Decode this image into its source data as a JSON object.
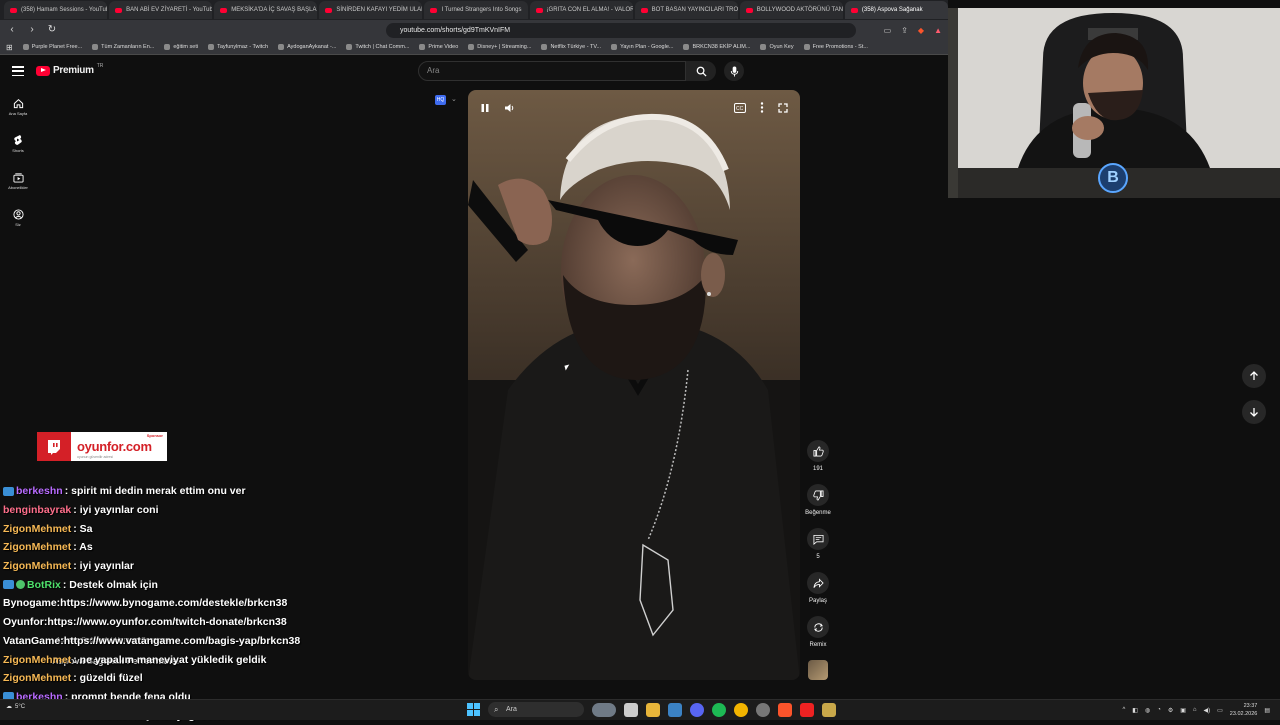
{
  "browser": {
    "tabs": [
      {
        "title": "(358) Hamam Sessions - YouTube"
      },
      {
        "title": "BAN ABİ EV ZİYARETİ - YouTube"
      },
      {
        "title": "MEKSİKA'DA İÇ SAVAŞ BAŞLADI"
      },
      {
        "title": "SİNİRDEN KAFAYI YEDİM ULAN"
      },
      {
        "title": "I Turned Strangers Into Songs"
      },
      {
        "title": "¡GRITA CON EL ALMA! - VALOR"
      },
      {
        "title": "BOT BASAN YAYINCILARI TROLLE"
      },
      {
        "title": "BOLLYWOOD AKTÖRÜNÜ TANI"
      },
      {
        "title": "(358) Aspova Sağanak"
      }
    ],
    "url": "youtube.com/shorts/gd9TmKVnIFM",
    "bookmarks": [
      "Purple Planet Free...",
      "Tüm Zamanların En...",
      "eğitim seti",
      "Tayfunylmaz - Twitch",
      "AydoganAykanat -...",
      "Twitch | Chat Comm...",
      "Prime Video",
      "Disney+ | Streaming...",
      "Netflix Türkiye - TV...",
      "Yayın Plan - Google...",
      "BRKCN38 EKİP ALIM...",
      "Oyun Key",
      "Free Promotions - St..."
    ]
  },
  "youtube": {
    "logo_text": "Premium",
    "logo_region": "TR",
    "search_placeholder": "Ara",
    "sidebar": [
      {
        "label": "Ana Sayfa",
        "icon": "home-icon"
      },
      {
        "label": "Shorts",
        "icon": "shorts-icon"
      },
      {
        "label": "Abonelikler",
        "icon": "subscriptions-icon"
      },
      {
        "label": "Siz",
        "icon": "profile-icon"
      }
    ],
    "quality_badge": "HQ",
    "actions": {
      "like_count": "191",
      "dislike_label": "Beğenme",
      "comments_count": "5",
      "share_label": "Paylaş",
      "remix_label": "Remix"
    }
  },
  "overlay": {
    "sponsor_logo_text": "oyunfor.com",
    "sponsor_tag": "Sponsor",
    "sponsor_sub": "oyunun güvenilir adresi",
    "now_playing_sub": "Aspova Sağanak | Hamam Sessions",
    "now_playing_title": "Aspova Sağanak Performansı"
  },
  "chat": [
    {
      "user": "berkeshn",
      "color": "#b86bff",
      "badge": true,
      "message": " : spirit mi dedin merak ettim onu ver"
    },
    {
      "user": "benginbayrak",
      "color": "#ff6f8b",
      "badge": false,
      "message": " : iyi yayınlar coni"
    },
    {
      "user": "ZigonMehmet",
      "color": "#f7b955",
      "badge": false,
      "message": " : Sa"
    },
    {
      "user": "ZigonMehmet",
      "color": "#f7b955",
      "badge": false,
      "message": " : As"
    },
    {
      "user": "ZigonMehmet",
      "color": "#f7b955",
      "badge": false,
      "message": " : iyi yayınlar"
    },
    {
      "user": "BotRix",
      "color": "#4ee06b",
      "badge": true,
      "message": " : Destek olmak için"
    },
    {
      "user": "",
      "color": "#ffffff",
      "badge": false,
      "message": "Bynogame:https://www.bynogame.com/destekle/brkcn38"
    },
    {
      "user": "",
      "color": "#ffffff",
      "badge": false,
      "message": "Oyunfor:https://www.oyunfor.com/twitch-donate/brkcn38"
    },
    {
      "user": "",
      "color": "#ffffff",
      "badge": false,
      "message": "VatanGame:https://www.vatangame.com/bagis-yap/brkcn38"
    },
    {
      "user": "ZigonMehmet",
      "color": "#f7b955",
      "badge": false,
      "message": " : ne yapalım maneviyat yükledik geldik"
    },
    {
      "user": "ZigonMehmet",
      "color": "#f7b955",
      "badge": false,
      "message": " : güzeldi füzel"
    },
    {
      "user": "berkeshn",
      "color": "#b86bff",
      "badge": true,
      "message": " : prompt bende fena oldu"
    },
    {
      "user": "berkeshn",
      "color": "#b86bff",
      "badge": true,
      "message": " : ben ufaktan kaçanzi iyi geceler"
    }
  ],
  "taskbar": {
    "search_placeholder": "Ara",
    "time": "23:37",
    "date": "23.02.2026",
    "weather": "5°C"
  }
}
